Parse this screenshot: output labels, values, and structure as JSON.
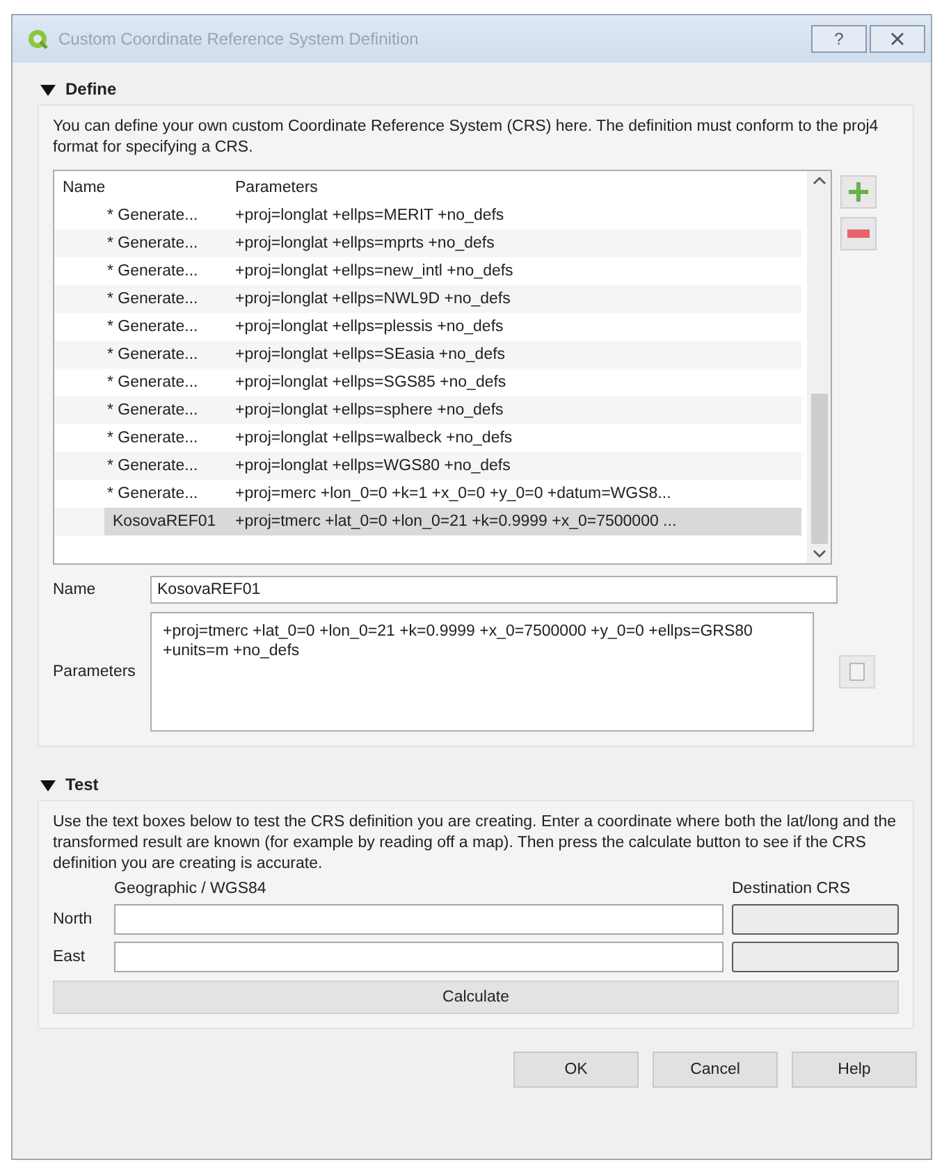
{
  "window": {
    "title": "Custom Coordinate Reference System Definition",
    "help_button": "?"
  },
  "define": {
    "title": "Define",
    "expanded": true,
    "description": "You can define your own custom Coordinate Reference System (CRS) here. The definition must conform to the proj4 format for specifying a CRS.",
    "table": {
      "columns": [
        "Name",
        "Parameters"
      ],
      "rows": [
        {
          "name": "* Generate...",
          "parameters": "+proj=longlat +ellps=MERIT +no_defs",
          "selected": false
        },
        {
          "name": "* Generate...",
          "parameters": "+proj=longlat +ellps=mprts +no_defs",
          "selected": false
        },
        {
          "name": "* Generate...",
          "parameters": "+proj=longlat +ellps=new_intl +no_defs",
          "selected": false
        },
        {
          "name": "* Generate...",
          "parameters": "+proj=longlat +ellps=NWL9D +no_defs",
          "selected": false
        },
        {
          "name": "* Generate...",
          "parameters": "+proj=longlat +ellps=plessis +no_defs",
          "selected": false
        },
        {
          "name": "* Generate...",
          "parameters": "+proj=longlat +ellps=SEasia +no_defs",
          "selected": false
        },
        {
          "name": "* Generate...",
          "parameters": "+proj=longlat +ellps=SGS85 +no_defs",
          "selected": false
        },
        {
          "name": "* Generate...",
          "parameters": "+proj=longlat +ellps=sphere +no_defs",
          "selected": false
        },
        {
          "name": "* Generate...",
          "parameters": "+proj=longlat +ellps=walbeck +no_defs",
          "selected": false
        },
        {
          "name": "* Generate...",
          "parameters": "+proj=longlat +ellps=WGS80 +no_defs",
          "selected": false
        },
        {
          "name": "* Generate...",
          "parameters": "+proj=merc +lon_0=0 +k=1 +x_0=0 +y_0=0 +datum=WGS8...",
          "selected": false
        },
        {
          "name": "KosovaREF01",
          "parameters": "+proj=tmerc +lat_0=0 +lon_0=21 +k=0.9999 +x_0=7500000 ...",
          "selected": true
        }
      ]
    },
    "name_label": "Name",
    "name_value": "KosovaREF01",
    "parameters_label": "Parameters",
    "parameters_value": "+proj=tmerc +lat_0=0 +lon_0=21 +k=0.9999 +x_0=7500000 +y_0=0 +ellps=GRS80 +units=m +no_defs"
  },
  "test": {
    "title": "Test",
    "expanded": true,
    "description": "Use the text boxes below to test the CRS definition you are creating. Enter a coordinate where both the lat/long and the transformed result are known (for example by reading off a map). Then press the calculate button to see if the CRS definition you are creating is accurate.",
    "source_label": "Geographic / WGS84",
    "destination_label": "Destination CRS",
    "rows": [
      "North",
      "East"
    ],
    "calculate_button": "Calculate"
  },
  "buttons": [
    "OK",
    "Cancel",
    "Help"
  ]
}
